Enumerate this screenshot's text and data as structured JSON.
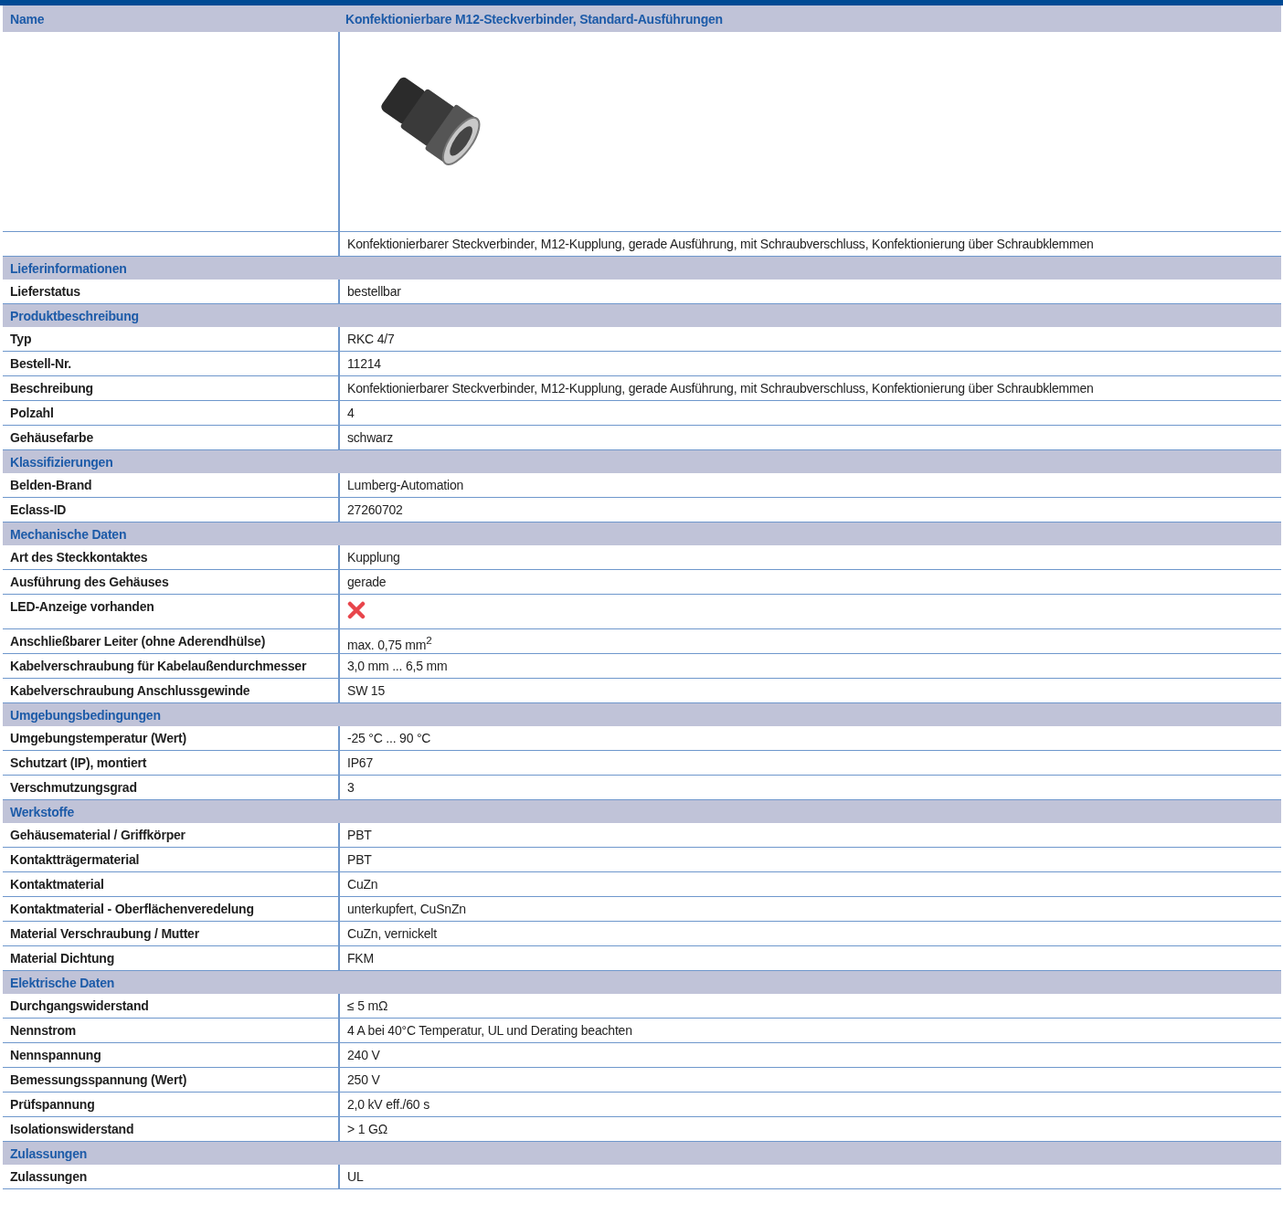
{
  "header": {
    "label": "Name",
    "title": "Konfektionierbare M12-Steckverbinder, Standard-Ausführungen"
  },
  "image_row": {
    "description": "Konfektionierbarer Steckverbinder, M12-Kupplung, gerade Ausführung, mit Schraubverschluss, Konfektionierung über Schraubklemmen"
  },
  "sections": [
    {
      "title": "Lieferinformationen",
      "rows": [
        {
          "kind": "text",
          "label": "Lieferstatus",
          "value": "bestellbar"
        }
      ]
    },
    {
      "title": "Produktbeschreibung",
      "rows": [
        {
          "kind": "text",
          "label": "Typ",
          "value": "RKC 4/7"
        },
        {
          "kind": "text",
          "label": "Bestell-Nr.",
          "value": "11214"
        },
        {
          "kind": "text",
          "label": "Beschreibung",
          "value": "Konfektionierbarer Steckverbinder, M12-Kupplung, gerade Ausführung, mit Schraubverschluss, Konfektionierung über Schraubklemmen"
        },
        {
          "kind": "text",
          "label": "Polzahl",
          "value": "4"
        },
        {
          "kind": "text",
          "label": "Gehäusefarbe",
          "value": "schwarz"
        }
      ]
    },
    {
      "title": "Klassifizierungen",
      "rows": [
        {
          "kind": "text",
          "label": "Belden-Brand",
          "value": "Lumberg-Automation"
        },
        {
          "kind": "text",
          "label": "Eclass-ID",
          "value": "27260702"
        }
      ]
    },
    {
      "title": "Mechanische Daten",
      "rows": [
        {
          "kind": "text",
          "label": "Art des Steckkontaktes",
          "value": "Kupplung"
        },
        {
          "kind": "text",
          "label": "Ausführung des Gehäuses",
          "value": "gerade"
        },
        {
          "kind": "boolean",
          "label": "LED-Anzeige vorhanden",
          "checked": false
        },
        {
          "kind": "text",
          "label": "Anschließbarer Leiter (ohne Aderendhülse)",
          "value": "max. 0,75 mm$^{2}$"
        },
        {
          "kind": "text",
          "label": "Kabelverschraubung für Kabelaußendurchmesser",
          "value": "3,0 mm ... 6,5 mm"
        },
        {
          "kind": "text",
          "label": "Kabelverschraubung Anschlussgewinde",
          "value": "SW 15"
        }
      ]
    },
    {
      "title": "Umgebungsbedingungen",
      "rows": [
        {
          "kind": "text",
          "label": "Umgebungstemperatur (Wert)",
          "value": "-25 °C ... 90 °C"
        },
        {
          "kind": "text",
          "label": "Schutzart (IP), montiert",
          "value": "IP67"
        },
        {
          "kind": "text",
          "label": "Verschmutzungsgrad",
          "value": "3"
        }
      ]
    },
    {
      "title": "Werkstoffe",
      "rows": [
        {
          "kind": "text",
          "label": "Gehäusematerial / Griffkörper",
          "value": "PBT"
        },
        {
          "kind": "text",
          "label": "Kontaktträgermaterial",
          "value": "PBT"
        },
        {
          "kind": "text",
          "label": "Kontaktmaterial",
          "value": "CuZn"
        },
        {
          "kind": "text",
          "label": "Kontaktmaterial - Oberflächenveredelung",
          "value": "unterkupfert, CuSnZn"
        },
        {
          "kind": "text",
          "label": "Material Verschraubung / Mutter",
          "value": "CuZn, vernickelt"
        },
        {
          "kind": "text",
          "label": "Material Dichtung",
          "value": "FKM"
        }
      ]
    },
    {
      "title": "Elektrische Daten",
      "rows": [
        {
          "kind": "text",
          "label": "Durchgangswiderstand",
          "value": "≤ 5 mΩ"
        },
        {
          "kind": "text",
          "label": "Nennstrom",
          "value": "4 A bei 40°C Temperatur, UL und Derating beachten"
        },
        {
          "kind": "text",
          "label": "Nennspannung",
          "value": "240 V"
        },
        {
          "kind": "text",
          "label": "Bemessungsspannung (Wert)",
          "value": "250 V"
        },
        {
          "kind": "text",
          "label": "Prüfspannung",
          "value": "2,0 kV eff./60 s"
        },
        {
          "kind": "text",
          "label": "Isolationswiderstand",
          "value": "> 1 GΩ"
        }
      ]
    },
    {
      "title": "Zulassungen",
      "rows": [
        {
          "kind": "text",
          "label": "Zulassungen",
          "value": "UL"
        }
      ]
    }
  ]
}
